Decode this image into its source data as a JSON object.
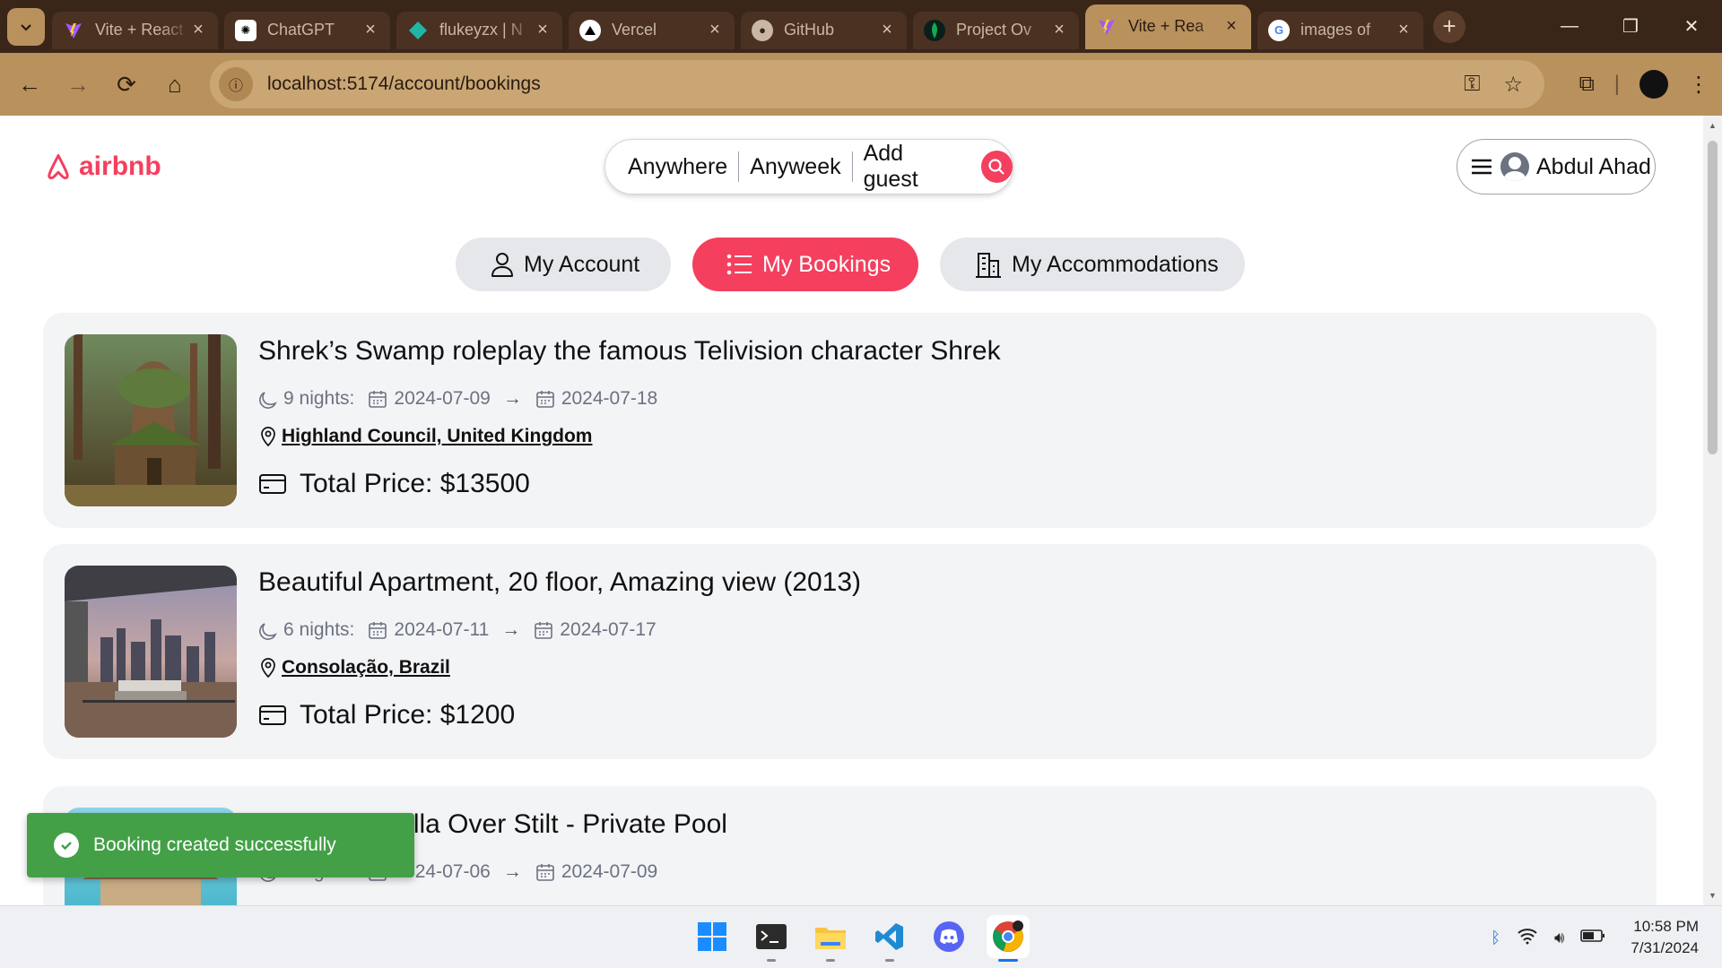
{
  "browser": {
    "tabs": [
      {
        "title": "Vite + React",
        "icon": "vite-icon",
        "active": false
      },
      {
        "title": "ChatGPT",
        "icon": "chatgpt-icon",
        "active": false
      },
      {
        "title": "flukeyzx | N",
        "icon": "diamond-icon",
        "active": false
      },
      {
        "title": "Vercel",
        "icon": "vercel-icon",
        "active": false
      },
      {
        "title": "GitHub",
        "icon": "github-icon",
        "active": false
      },
      {
        "title": "Project Ov",
        "icon": "mongodb-icon",
        "active": false
      },
      {
        "title": "Vite + Rea",
        "icon": "vite-icon",
        "active": true
      },
      {
        "title": "images of",
        "icon": "google-icon",
        "active": false
      }
    ],
    "url": "localhost:5174/account/bookings"
  },
  "header": {
    "logo_text": "airbnb",
    "search": {
      "where": "Anywhere",
      "when": "Anyweek",
      "guests": "Add guest"
    },
    "user_name": "Abdul Ahad"
  },
  "account_nav": [
    {
      "label": "My Account",
      "active": false
    },
    {
      "label": "My Bookings",
      "active": true
    },
    {
      "label": "My Accommodations",
      "active": false
    }
  ],
  "bookings": [
    {
      "title": "Shrek’s Swamp roleplay the famous Telivision character Shrek",
      "nights": "9 nights:",
      "check_in": "2024-07-09",
      "check_out": "2024-07-18",
      "location": "Highland Council, United Kingdom",
      "total_price": "Total Price: $13500"
    },
    {
      "title": "Beautiful Apartment, 20 floor, Amazing view (2013)",
      "nights": "6 nights:",
      "check_in": "2024-07-11",
      "check_out": "2024-07-17",
      "location": "Consolação, Brazil",
      "total_price": "Total Price: $1200"
    },
    {
      "title": "Overwater Villa Over Stilt - Private Pool",
      "nights": "3 nights:",
      "check_in": "2024-07-06",
      "check_out": "2024-07-09",
      "location": "",
      "total_price": ""
    }
  ],
  "toast": {
    "message": "Booking created successfully"
  },
  "taskbar": {
    "apps": [
      "windows-start-icon",
      "terminal-icon",
      "file-explorer-icon",
      "vscode-icon",
      "discord-icon",
      "chrome-icon"
    ],
    "time": "10:58 PM",
    "date": "7/31/2024"
  },
  "colors": {
    "brand": "#f43f5e",
    "toast": "#43a047",
    "chrome": "#b9915c",
    "tabbar": "#3a2519"
  }
}
